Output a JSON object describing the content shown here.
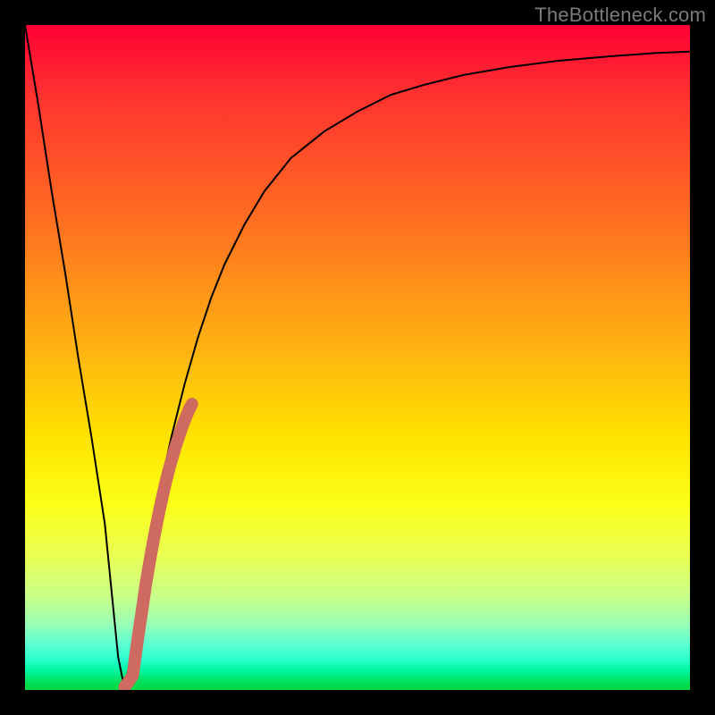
{
  "watermark": "TheBottleneck.com",
  "chart_data": {
    "type": "line",
    "title": "",
    "xlabel": "",
    "ylabel": "",
    "xlim": [
      0,
      100
    ],
    "ylim": [
      0,
      100
    ],
    "series": [
      {
        "name": "bottleneck-curve",
        "color": "#000000",
        "x": [
          0,
          2,
          4,
          6,
          8,
          10,
          12,
          13,
          14,
          15,
          16,
          18,
          20,
          22,
          24,
          26,
          28,
          30,
          33,
          36,
          40,
          45,
          50,
          55,
          60,
          66,
          73,
          80,
          88,
          95,
          100
        ],
        "y": [
          100,
          88,
          75,
          63,
          50,
          38,
          25,
          15,
          5,
          0,
          6,
          18,
          29,
          38,
          46,
          53,
          59,
          64,
          70,
          75,
          80,
          84,
          87,
          89.5,
          91,
          92.5,
          93.7,
          94.6,
          95.3,
          95.8,
          96
        ]
      },
      {
        "name": "highlight-dots",
        "color": "#cf6a61",
        "x": [
          15.0,
          15.6,
          16.2,
          17.0,
          17.6,
          18.1,
          18.6,
          19.1,
          19.6,
          20.1,
          20.6,
          21.1,
          21.6,
          22.1,
          22.6,
          23.1,
          23.6,
          24.1,
          24.6,
          25.1
        ],
        "y": [
          0.5,
          1.3,
          2.2,
          8.0,
          12.0,
          15.5,
          18.5,
          21.3,
          24.0,
          26.5,
          28.8,
          31.0,
          33.0,
          34.8,
          36.5,
          38.0,
          39.5,
          40.8,
          42.0,
          43.0
        ]
      }
    ]
  }
}
